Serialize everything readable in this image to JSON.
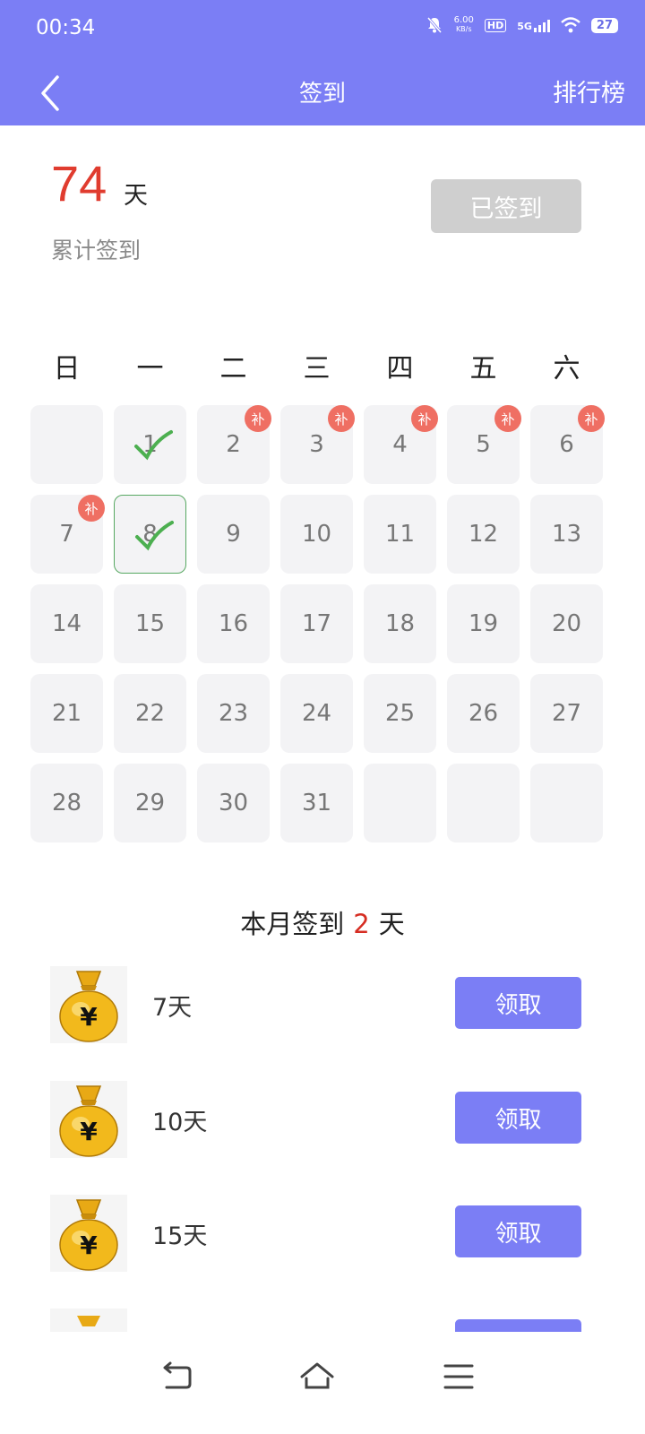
{
  "status_bar": {
    "time": "00:34",
    "speed": "6.00",
    "speed_unit": "KB/s",
    "hd": "HD",
    "network": "5G",
    "battery": "27"
  },
  "header": {
    "title": "签到",
    "right_action": "排行榜"
  },
  "summary": {
    "total_days": "74",
    "unit": "天",
    "label": "累计签到",
    "signed_button": "已签到"
  },
  "calendar": {
    "weekdays": [
      "日",
      "一",
      "二",
      "三",
      "四",
      "五",
      "六"
    ],
    "makeup_badge": "补",
    "rows": [
      [
        {
          "day": ""
        },
        {
          "day": "1",
          "checked": true
        },
        {
          "day": "2",
          "makeup": true
        },
        {
          "day": "3",
          "makeup": true
        },
        {
          "day": "4",
          "makeup": true
        },
        {
          "day": "5",
          "makeup": true
        },
        {
          "day": "6",
          "makeup": true
        }
      ],
      [
        {
          "day": "7",
          "makeup": true
        },
        {
          "day": "8",
          "checked": true,
          "today": true
        },
        {
          "day": "9"
        },
        {
          "day": "10"
        },
        {
          "day": "11"
        },
        {
          "day": "12"
        },
        {
          "day": "13"
        }
      ],
      [
        {
          "day": "14"
        },
        {
          "day": "15"
        },
        {
          "day": "16"
        },
        {
          "day": "17"
        },
        {
          "day": "18"
        },
        {
          "day": "19"
        },
        {
          "day": "20"
        }
      ],
      [
        {
          "day": "21"
        },
        {
          "day": "22"
        },
        {
          "day": "23"
        },
        {
          "day": "24"
        },
        {
          "day": "25"
        },
        {
          "day": "26"
        },
        {
          "day": "27"
        }
      ],
      [
        {
          "day": "28"
        },
        {
          "day": "29"
        },
        {
          "day": "30"
        },
        {
          "day": "31"
        },
        {
          "day": ""
        },
        {
          "day": ""
        },
        {
          "day": ""
        }
      ]
    ]
  },
  "monthly": {
    "prefix": "本月签到",
    "count": "2",
    "suffix": "天"
  },
  "rewards": [
    {
      "label": "7天",
      "button": "领取"
    },
    {
      "label": "10天",
      "button": "领取"
    },
    {
      "label": "15天",
      "button": "领取"
    }
  ],
  "colors": {
    "primary": "#7b7ef5",
    "accent_red": "#e03c2f",
    "check_green": "#4caf50",
    "badge": "#ef6f63"
  }
}
